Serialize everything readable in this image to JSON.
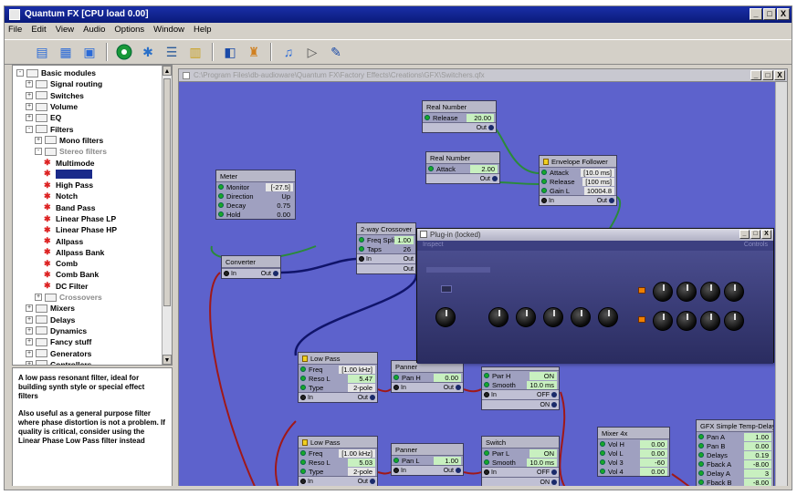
{
  "app": {
    "title": "Quantum FX [CPU load 0.00]",
    "controls": [
      "_",
      "□",
      "X"
    ]
  },
  "menu": [
    "File",
    "Edit",
    "View",
    "Audio",
    "Options",
    "Window",
    "Help"
  ],
  "toolbar_icons": [
    "new-icon",
    "open-icon",
    "save-icon",
    "green-globe-icon",
    "puzzle-icon",
    "list-icon",
    "table-icon",
    "window-icon",
    "tool-icon",
    "notes-icon",
    "play-icon",
    "wand-icon"
  ],
  "tree": {
    "items": [
      {
        "label": "Basic modules",
        "level": 0,
        "kind": "folder",
        "exp": "-"
      },
      {
        "label": "Signal routing",
        "level": 1,
        "kind": "folder",
        "exp": "+"
      },
      {
        "label": "Switches",
        "level": 1,
        "kind": "folder",
        "exp": "+"
      },
      {
        "label": "Volume",
        "level": 1,
        "kind": "folder",
        "exp": "+"
      },
      {
        "label": "EQ",
        "level": 1,
        "kind": "folder",
        "exp": "+"
      },
      {
        "label": "Filters",
        "level": 1,
        "kind": "folder",
        "exp": "-"
      },
      {
        "label": "Mono filters",
        "level": 2,
        "kind": "folder",
        "exp": "+"
      },
      {
        "label": "Stereo filters",
        "level": 2,
        "kind": "folder",
        "exp": "-",
        "dim": true
      },
      {
        "label": "Multimode",
        "level": 3,
        "kind": "module"
      },
      {
        "label": "",
        "level": 3,
        "kind": "module",
        "selected": true
      },
      {
        "label": "High Pass",
        "level": 3,
        "kind": "module"
      },
      {
        "label": "Notch",
        "level": 3,
        "kind": "module"
      },
      {
        "label": "Band Pass",
        "level": 3,
        "kind": "module"
      },
      {
        "label": "Linear Phase LP",
        "level": 3,
        "kind": "module"
      },
      {
        "label": "Linear Phase HP",
        "level": 3,
        "kind": "module"
      },
      {
        "label": "Allpass",
        "level": 3,
        "kind": "module"
      },
      {
        "label": "Allpass Bank",
        "level": 3,
        "kind": "module"
      },
      {
        "label": "Comb",
        "level": 3,
        "kind": "module"
      },
      {
        "label": "Comb Bank",
        "level": 3,
        "kind": "module"
      },
      {
        "label": "DC Filter",
        "level": 3,
        "kind": "module"
      },
      {
        "label": "Crossovers",
        "level": 2,
        "kind": "folder",
        "exp": "+",
        "dim": true
      },
      {
        "label": "Mixers",
        "level": 1,
        "kind": "folder",
        "exp": "+"
      },
      {
        "label": "Delays",
        "level": 1,
        "kind": "folder",
        "exp": "+"
      },
      {
        "label": "Dynamics",
        "level": 1,
        "kind": "folder",
        "exp": "+"
      },
      {
        "label": "Fancy stuff",
        "level": 1,
        "kind": "folder",
        "exp": "+"
      },
      {
        "label": "Generators",
        "level": 1,
        "kind": "folder",
        "exp": "+"
      },
      {
        "label": "Controllers",
        "level": 1,
        "kind": "folder",
        "exp": "+"
      }
    ]
  },
  "description": {
    "p1": "A low pass resonant filter, ideal for building synth style or special effect filters",
    "p2": "Also useful as a general purpose filter where phase distortion is not a problem. If quality is critical, consider using the Linear Phase Low Pass filter instead"
  },
  "document": {
    "title": "C:\\Program Files\\db-audioware\\Quantum FX\\Factory Effects\\Creations\\GFX\\Switchers.qfx",
    "controls": [
      "_",
      "□",
      "X"
    ]
  },
  "nodes": {
    "real1": {
      "title": "Real Number",
      "params": [
        {
          "name": "Release",
          "value": "20.00"
        }
      ],
      "out": "Out"
    },
    "real2": {
      "title": "Real Number",
      "params": [
        {
          "name": "Attack",
          "value": "2.00"
        }
      ],
      "out": "Out"
    },
    "env": {
      "title": "Envelope Follower",
      "params": [
        {
          "name": "Attack",
          "value": "[10.0 ms]"
        },
        {
          "name": "Release",
          "value": "[100 ms]"
        },
        {
          "name": "Gain L",
          "value": "10004.8"
        }
      ],
      "in": "In",
      "out": "Out"
    },
    "meter": {
      "title": "Meter",
      "params": [
        {
          "name": "Monitor",
          "value": "[-27.5]"
        },
        {
          "name": "Direction",
          "value": "Up"
        },
        {
          "name": "Decay",
          "value": "0.75"
        },
        {
          "name": "Hold",
          "value": "0.00"
        }
      ]
    },
    "xover": {
      "title": "2-way Crossover",
      "params": [
        {
          "name": "Freq Split",
          "value": "1.00"
        },
        {
          "name": "Taps",
          "value": "26"
        }
      ],
      "in": "In",
      "out1": "Out",
      "out2": "Out"
    },
    "conv": {
      "title": "Converter",
      "in": "In",
      "out": "Out"
    },
    "lp1": {
      "title": "Low Pass",
      "params": [
        {
          "name": "Freq",
          "value": "[1.00 kHz]"
        },
        {
          "name": "Reso L",
          "value": "5.47"
        },
        {
          "name": "Type",
          "value": "2-pole"
        }
      ],
      "in": "In",
      "out": "Out"
    },
    "pan1": {
      "title": "Panner",
      "params": [
        {
          "name": "Pan H",
          "value": "0.00"
        }
      ],
      "in": "In",
      "out": "Out"
    },
    "sw1": {
      "title": "",
      "params": [
        {
          "name": "Pwr H",
          "value": "ON"
        },
        {
          "name": "Smooth",
          "value": "10.0 ms"
        }
      ],
      "in": "In",
      "out1": "OFF",
      "out2": "ON"
    },
    "lp2": {
      "title": "Low Pass",
      "params": [
        {
          "name": "Freq",
          "value": "[1.00 kHz]"
        },
        {
          "name": "Reso L",
          "value": "5.03"
        },
        {
          "name": "Type",
          "value": "2-pole"
        }
      ],
      "in": "In",
      "out": "Out"
    },
    "pan2": {
      "title": "Panner",
      "params": [
        {
          "name": "Pan L",
          "value": "1.00"
        }
      ],
      "in": "In",
      "out": "Out"
    },
    "sw2": {
      "title": "Switch",
      "params": [
        {
          "name": "Pwr L",
          "value": "ON"
        },
        {
          "name": "Smooth",
          "value": "10.0 ms"
        }
      ],
      "in": "In",
      "out1": "OFF",
      "out2": "ON"
    },
    "mix": {
      "title": "Mixer 4x",
      "params": [
        {
          "name": "Vol H",
          "value": "0.00"
        },
        {
          "name": "Vol L",
          "value": "0.00"
        },
        {
          "name": "Vol 3",
          "value": "-60"
        },
        {
          "name": "Vol 4",
          "value": "0.00"
        }
      ],
      "in": "In",
      "out": "Out"
    },
    "tempo": {
      "title": "GFX Simple Temp-Delay",
      "params": [
        {
          "name": "Pan A",
          "value": "1.00"
        },
        {
          "name": "Pan B",
          "value": "0.00"
        },
        {
          "name": "Delays",
          "value": "0.19"
        },
        {
          "name": "Fback A",
          "value": "-8.00"
        },
        {
          "name": "Delay A",
          "value": "3"
        },
        {
          "name": "Fback B",
          "value": "-8.00"
        }
      ]
    }
  },
  "plugin": {
    "title": "Plug-in (locked)",
    "subtitle_left": "Inspect",
    "subtitle_right": "Controls"
  },
  "colors": {
    "canvas": "#5d62cc",
    "title_bar": "#1a2fa8",
    "param_value": "#c8f0c0",
    "wire_green": "#2a8a3a",
    "wire_red": "#a01818",
    "wire_blue": "#10146a",
    "led": "#f08000"
  }
}
